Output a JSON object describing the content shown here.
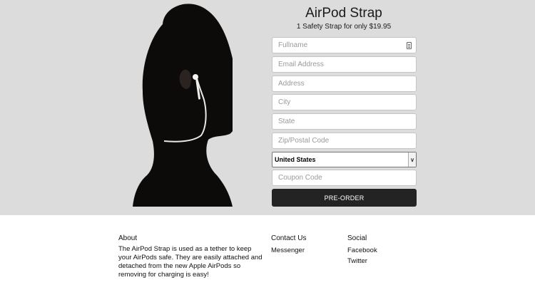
{
  "product": {
    "title": "AirPod Strap",
    "subtitle": "1 Safety Strap for only $19.95"
  },
  "form": {
    "fullname_placeholder": "Fullname",
    "email_placeholder": "Email Address",
    "address_placeholder": "Address",
    "city_placeholder": "City",
    "state_placeholder": "State",
    "zip_placeholder": "Zip/Postal Code",
    "country_value": "United States",
    "coupon_placeholder": "Coupon Code",
    "submit_label": "PRE-ORDER"
  },
  "footer": {
    "about_heading": "About",
    "about_text": "The AirPod Strap is used as a tether to keep your AirPods safe. They are easily attached and detached from the new Apple AirPods so removing for charging is easy!",
    "contact_heading": "Contact Us",
    "contact_links": [
      "Messenger"
    ],
    "social_heading": "Social",
    "social_links": [
      "Facebook",
      "Twitter"
    ]
  },
  "colors": {
    "hero_background": "#dcdcdc",
    "button_background": "#232323"
  },
  "icons": {
    "autofill": "contact-card-icon",
    "select_caret": "chevron-down-icon"
  }
}
